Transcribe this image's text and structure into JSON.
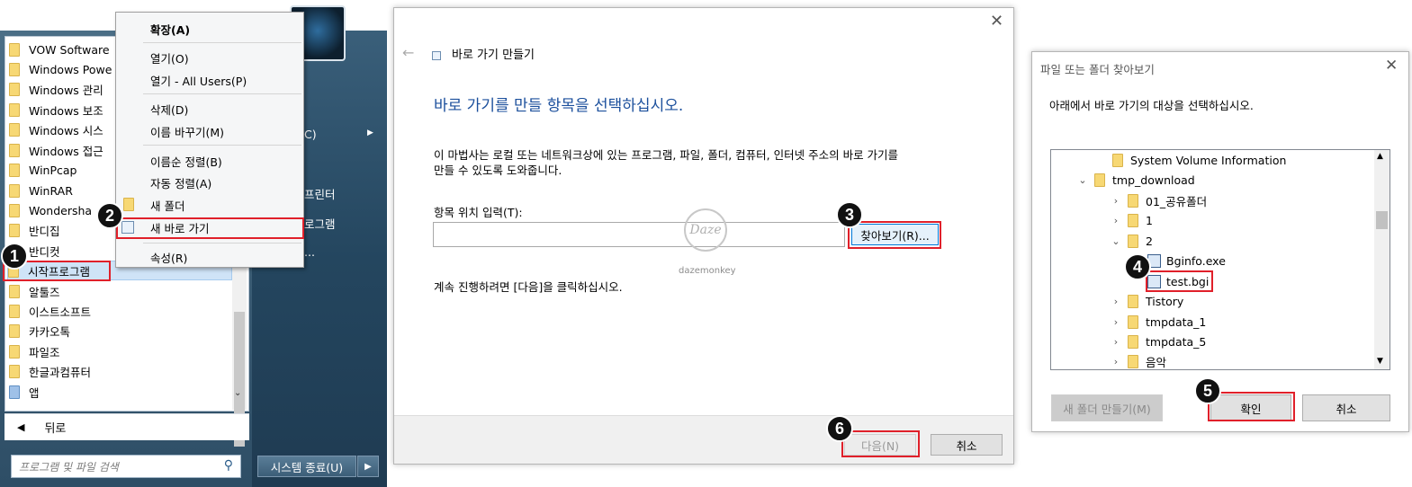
{
  "startmenu": {
    "programs": [
      {
        "label": "VOW Software"
      },
      {
        "label": "Windows Powe"
      },
      {
        "label": "Windows 관리"
      },
      {
        "label": "Windows 보조"
      },
      {
        "label": "Windows 시스"
      },
      {
        "label": "Windows 접근"
      },
      {
        "label": "WinPcap"
      },
      {
        "label": "WinRAR"
      },
      {
        "label": "Wondersha"
      },
      {
        "label": "반디집"
      },
      {
        "label": "반디컷"
      },
      {
        "label": "시작프로그램"
      },
      {
        "label": "알툴즈"
      },
      {
        "label": "이스트소프트"
      },
      {
        "label": "카카오톡"
      },
      {
        "label": "파일조"
      },
      {
        "label": "한글과컴퓨터"
      },
      {
        "label": "앱"
      }
    ],
    "back_label": "뒤로",
    "search_placeholder": "프로그램 및 파일 검색",
    "shutdown_label": "시스템 종료(U)",
    "right_items": [
      "C)",
      "프린터",
      "로그램",
      "..."
    ]
  },
  "context_menu": {
    "items": [
      "확장(A)",
      "열기(O)",
      "열기 - All Users(P)",
      "삭제(D)",
      "이름 바꾸기(M)",
      "이름순 정렬(B)",
      "자동 정렬(A)",
      "새 폴더",
      "새 바로 가기",
      "속성(R)"
    ]
  },
  "badges": [
    "1",
    "2",
    "3",
    "4",
    "5",
    "6"
  ],
  "wizard": {
    "title": "바로 가기 만들기",
    "heading": "바로 가기를 만들 항목을 선택하십시오.",
    "desc_line1": "이 마법사는 로컬 또는 네트워크상에 있는 프로그램, 파일, 폴더, 컴퓨터, 인터넷 주소의 바로 가기를",
    "desc_line2": "만들 수 있도록 도와줍니다.",
    "field_label": "항목 위치 입력(T):",
    "field_value": "",
    "browse_button": "찾아보기(R)...",
    "continue_text": "계속 진행하려면 [다음]을 클릭하십시오.",
    "next_button": "다음(N)",
    "cancel_button": "취소",
    "watermark_logo": "Daze",
    "watermark_text": "dazemonkey"
  },
  "browse": {
    "title": "파일 또는 폴더 찾아보기",
    "instruction": "아래에서 바로 가기의 대상을 선택하십시오.",
    "tree": [
      {
        "label": "System Volume Information",
        "type": "folder",
        "chevron": ""
      },
      {
        "label": "tmp_download",
        "type": "folder",
        "chevron": "⌄"
      },
      {
        "label": "01_공유폴더",
        "type": "folder",
        "chevron": "›"
      },
      {
        "label": "1",
        "type": "folder",
        "chevron": "›"
      },
      {
        "label": "2",
        "type": "folder",
        "chevron": "⌄"
      },
      {
        "label": "Bginfo.exe",
        "type": "file",
        "chevron": ""
      },
      {
        "label": "test.bgi",
        "type": "file",
        "chevron": ""
      },
      {
        "label": "Tistory",
        "type": "folder",
        "chevron": "›"
      },
      {
        "label": "tmpdata_1",
        "type": "folder",
        "chevron": "›"
      },
      {
        "label": "tmpdata_5",
        "type": "folder",
        "chevron": "›"
      },
      {
        "label": "음악",
        "type": "folder",
        "chevron": "›"
      }
    ],
    "new_folder_button": "새 폴더 만들기(M)",
    "ok_button": "확인",
    "cancel_button": "취소"
  }
}
